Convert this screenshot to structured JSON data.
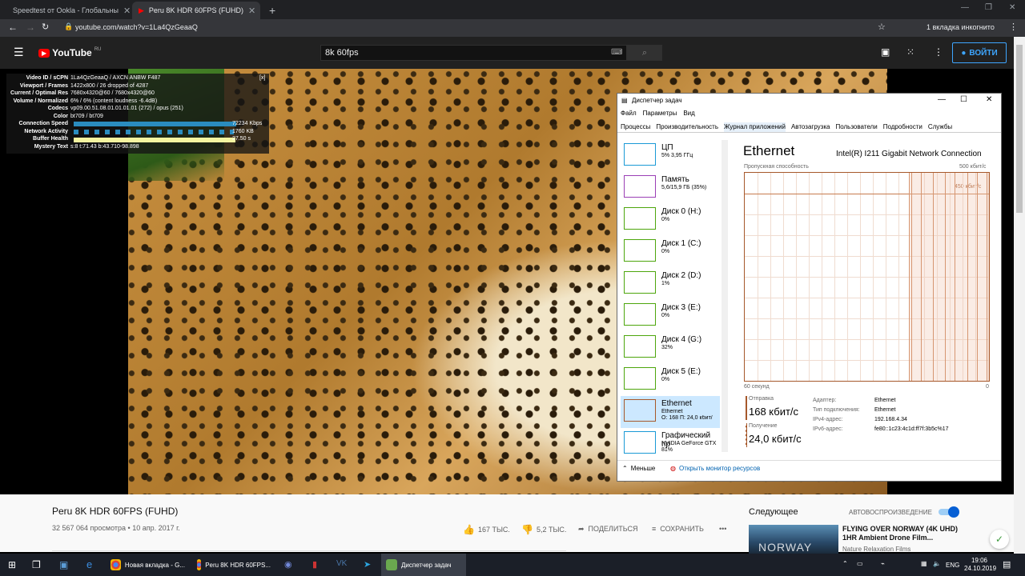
{
  "browser": {
    "tabs": [
      {
        "title": "Speedtest от Ookla - Глобальны",
        "active": false
      },
      {
        "title": "Peru 8K HDR 60FPS (FUHD)",
        "active": true
      }
    ],
    "new_tab": "+",
    "url": "youtube.com/watch?v=1La4QzGeaaQ",
    "incognito_label": "1 вкладка инкогнито"
  },
  "youtube": {
    "logo": "YouTube",
    "logo_region": "RU",
    "search_value": "8k 60fps",
    "signin_label": "ВОЙТИ"
  },
  "stats": {
    "rows": [
      {
        "k": "Video ID / sCPN",
        "v": "1La4QzGeaaQ / AXCN ANBW F487"
      },
      {
        "k": "Viewport / Frames",
        "v": "1422x800 / 26 dropped of 4287"
      },
      {
        "k": "Current / Optimal Res",
        "v": "7680x4320@60 / 7680x4320@60"
      },
      {
        "k": "Volume / Normalized",
        "v": "6% / 6% (content loudness -6.4dB)"
      },
      {
        "k": "Codecs",
        "v": "vp09.00.51.08.01.01.01.01 (272) / opus (251)"
      },
      {
        "k": "Color",
        "v": "bt709 / bt709"
      },
      {
        "k": "Connection Speed",
        "v": "72234 Kbps"
      },
      {
        "k": "Network Activity",
        "v": "1760 KB"
      },
      {
        "k": "Buffer Health",
        "v": "27.50 s"
      },
      {
        "k": "Mystery Text",
        "v": "s:8 t:71.43 b:43.710-98.898"
      }
    ],
    "close": "[x]",
    "connection_fill": 0.9,
    "buffer_fill": 0.84,
    "colors": {
      "connection": "#2a8cbf",
      "buffer": "#f4f4a0"
    }
  },
  "taskmgr": {
    "title": "Диспетчер задач",
    "menu": [
      "Файл",
      "Параметры",
      "Вид"
    ],
    "tabs": [
      "Процессы",
      "Производительность",
      "Журнал приложений",
      "Автозагрузка",
      "Пользователи",
      "Подробности",
      "Службы"
    ],
    "selected_tab": 1,
    "sidebar": [
      {
        "name": "ЦП",
        "l2": "5% 3,95 ГГц",
        "l3": ""
      },
      {
        "name": "Память",
        "l2": "5,6/15,9 ГБ (35%)",
        "l3": ""
      },
      {
        "name": "Диск 0 (H:)",
        "l2": "0%",
        "l3": ""
      },
      {
        "name": "Диск 1 (C:)",
        "l2": "0%",
        "l3": ""
      },
      {
        "name": "Диск 2 (D:)",
        "l2": "1%",
        "l3": ""
      },
      {
        "name": "Диск 3 (E:)",
        "l2": "0%",
        "l3": ""
      },
      {
        "name": "Диск 4 (G:)",
        "l2": "32%",
        "l3": ""
      },
      {
        "name": "Диск 5 (E:)",
        "l2": "0%",
        "l3": ""
      },
      {
        "name": "Ethernet",
        "l2": "Ethernet",
        "l3": "О: 168 П: 24,0 кбит/"
      },
      {
        "name": "Графический пр",
        "l2": "NVIDIA GeForce GTX",
        "l3": "81%"
      }
    ],
    "selected_side": 8,
    "heading": "Ethernet",
    "adapter": "Intel(R) I211 Gigabit Network Connection",
    "throughput_label": "Пропускная способность",
    "scale_max": "500 кбит/с",
    "scale_mid": "450 кбит/с",
    "time_label": "60 секунд",
    "zero": "0",
    "send_label": "Отправка",
    "send_value": "168 кбит/с",
    "recv_label": "Получение",
    "recv_value": "24,0 кбит/с",
    "details": [
      {
        "k": "Адаптер:",
        "v": "Ethernet"
      },
      {
        "k": "Тип подключения:",
        "v": "Ethernet"
      },
      {
        "k": "IPv4-адрес:",
        "v": "192.168.4.34"
      },
      {
        "k": "IPv6-адрес:",
        "v": "fe80::1c23:4c1d:ff7f:3b5c%17"
      }
    ],
    "less": "Меньше",
    "monitor": "Открыть монитор ресурсов"
  },
  "video": {
    "title": "Peru 8K HDR 60FPS (FUHD)",
    "meta": "32 567 064 просмотра • 10 апр. 2017 г.",
    "likes": "167 ТЫС.",
    "dislikes": "5,2 ТЫС.",
    "share": "ПОДЕЛИТЬСЯ",
    "save": "СОХРАНИТЬ",
    "more": "•••"
  },
  "next": {
    "label": "Следующее",
    "autoplay": "АВТОВОСПРОИЗВЕДЕНИЕ",
    "thumb_text": "NORWAY",
    "title": "FLYING OVER NORWAY (4K UHD) 1HR Ambient Drone Film...",
    "channel": "Nature Relaxation Films"
  },
  "taskbar": {
    "items": [
      {
        "label": "Новая вкладка - G...",
        "active": false
      },
      {
        "label": "Peru 8K HDR 60FPS...",
        "active": false
      },
      {
        "label": "Диспетчер задач",
        "active": true
      }
    ],
    "lang": "ENG",
    "time": "19:06",
    "date": "24.10.2019"
  }
}
